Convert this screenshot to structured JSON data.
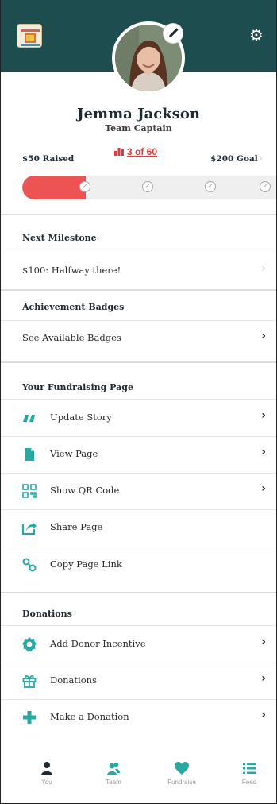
{
  "profile": {
    "name": "Jemma Jackson",
    "role": "Team Captain"
  },
  "progress": {
    "raised": "$50 Raised",
    "rank": "3 of 60",
    "goal": "$200 Goal",
    "raised_fraction": 0.25
  },
  "next_milestone": {
    "title": "Next Milestone",
    "item": "$100: Halfway there!"
  },
  "achievement_badges": {
    "title": "Achievement Badges",
    "item": "See Available Badges"
  },
  "fundraising_page": {
    "title": "Your Fundraising Page",
    "items": [
      {
        "label": "Update Story",
        "icon": "quote-icon"
      },
      {
        "label": "View Page",
        "icon": "document-icon"
      },
      {
        "label": "Show QR Code",
        "icon": "qr-code-icon"
      },
      {
        "label": "Share Page",
        "icon": "share-icon"
      },
      {
        "label": "Copy Page Link",
        "icon": "link-icon"
      }
    ]
  },
  "donations": {
    "title": "Donations",
    "items": [
      {
        "label": "Add Donor Incentive",
        "icon": "badge-icon"
      },
      {
        "label": "Donations",
        "icon": "gift-icon"
      },
      {
        "label": "Make a Donation",
        "icon": "plus-icon"
      }
    ]
  },
  "tabbar": {
    "items": [
      {
        "label": "You",
        "icon": "person-icon"
      },
      {
        "label": "Team",
        "icon": "team-icon"
      },
      {
        "label": "Fundraise",
        "icon": "heart-icon"
      },
      {
        "label": "Feed",
        "icon": "list-icon"
      }
    ]
  },
  "colors": {
    "header": "#1d4d4f",
    "accent": "#2aa9a0",
    "progress": "#ec5454"
  }
}
